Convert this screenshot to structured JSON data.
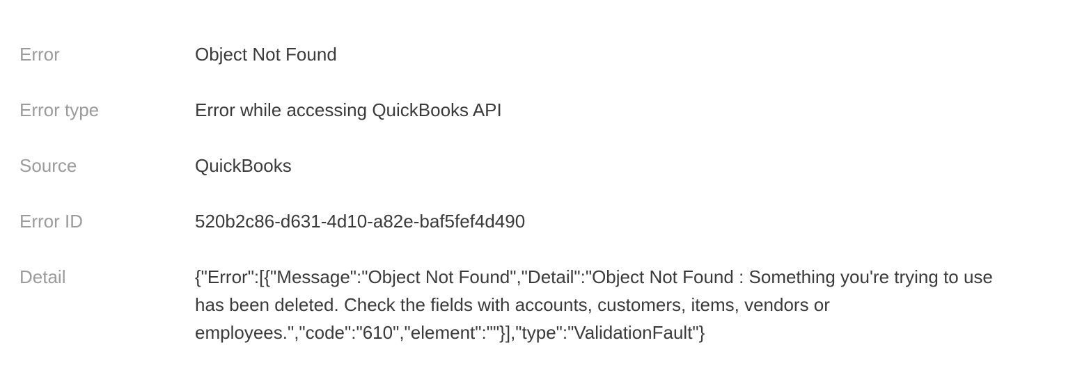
{
  "error_details": {
    "rows": [
      {
        "label": "Error",
        "value": "Object Not Found"
      },
      {
        "label": "Error type",
        "value": "Error while accessing QuickBooks API"
      },
      {
        "label": "Source",
        "value": "QuickBooks"
      },
      {
        "label": "Error ID",
        "value": "520b2c86-d631-4d10-a82e-baf5fef4d490"
      },
      {
        "label": "Detail",
        "value": "{\"Error\":[{\"Message\":\"Object Not Found\",\"Detail\":\"Object Not Found : Something you're trying to use has been deleted. Check the fields with accounts, customers, items, vendors or employees.\",\"code\":\"610\",\"element\":\"\"}],\"type\":\"ValidationFault\"}"
      }
    ]
  }
}
